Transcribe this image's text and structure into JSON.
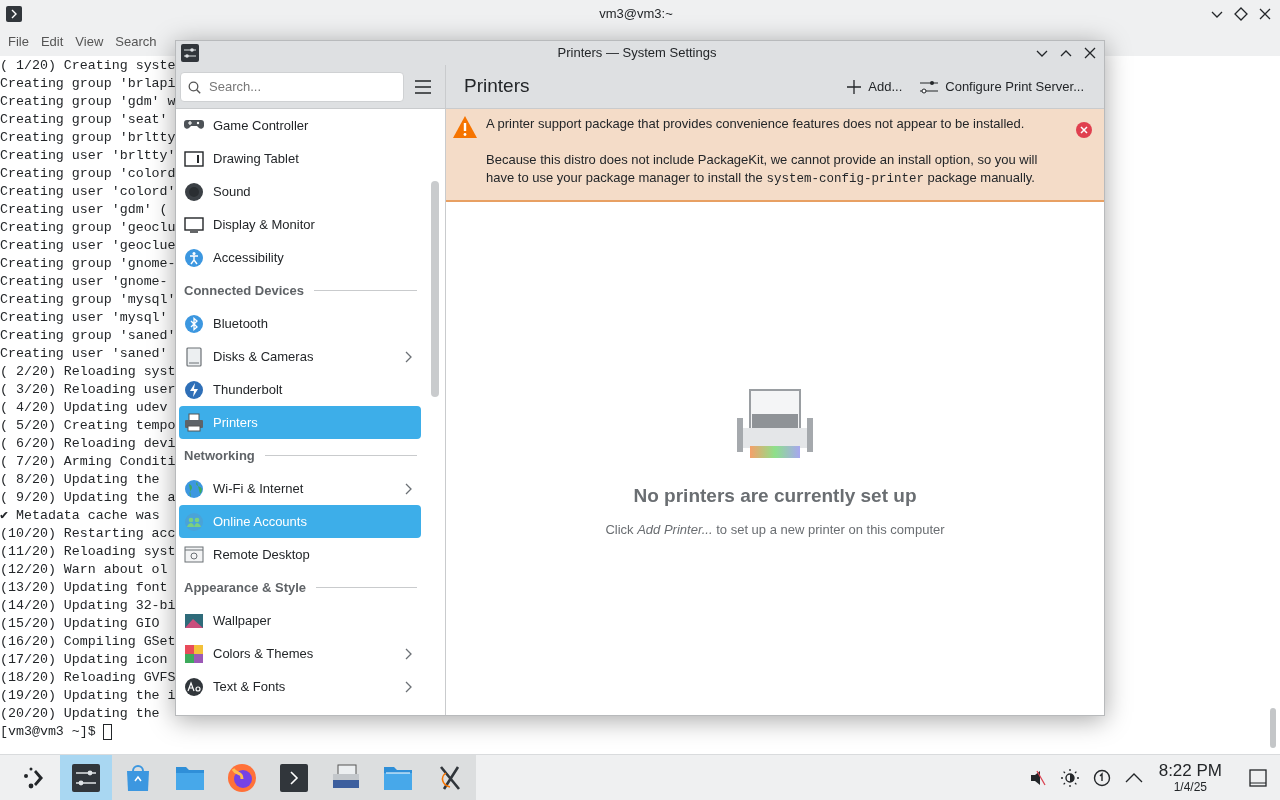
{
  "terminal": {
    "title": "vm3@vm3:~",
    "menu": [
      "File",
      "Edit",
      "View",
      "Search"
    ],
    "lines": [
      "( 1/20) Creating syste",
      "Creating group 'brlapi",
      "Creating group 'gdm' w",
      "Creating group 'seat'",
      "Creating group 'brltty",
      "Creating user 'brltty'",
      "Creating group 'colord",
      "Creating user 'colord'",
      "Creating user 'gdm' (",
      "Creating group 'geoclu",
      "Creating user 'geoclue",
      "Creating group 'gnome-",
      "Creating user 'gnome-",
      "Creating group 'mysql'",
      "Creating user 'mysql'",
      "Creating group 'saned'",
      "Creating user 'saned'",
      "( 2/20) Reloading syst",
      "( 3/20) Reloading user",
      "( 4/20) Updating udev",
      "( 5/20) Creating tempo",
      "( 6/20) Reloading devi",
      "( 7/20) Arming Conditi",
      "( 8/20) Updating the",
      "( 9/20) Updating the a",
      "✔ Metadata cache was",
      "(10/20) Restarting acc",
      "(11/20) Reloading syst",
      "(12/20) Warn about ol",
      "(13/20) Updating font",
      "(14/20) Updating 32-bi",
      "(15/20) Updating GIO",
      "(16/20) Compiling GSet",
      "(17/20) Updating icon",
      "(18/20) Reloading GVFS",
      "(19/20) Updating the i",
      "(20/20) Updating the"
    ],
    "prompt": "[vm3@vm3 ~]$"
  },
  "settings": {
    "title": "Printers — System Settings",
    "search": {
      "placeholder": "Search..."
    },
    "page_title": "Printers",
    "actions": [
      {
        "kind": "add",
        "label": "Add..."
      },
      {
        "kind": "configure",
        "label": "Configure Print Server..."
      }
    ],
    "sidebar": [
      {
        "items": [
          {
            "kind": "gamepad",
            "label": "Game Controller",
            "has_children": false,
            "selected": false
          },
          {
            "kind": "tablet",
            "label": "Drawing Tablet",
            "has_children": false,
            "selected": false
          },
          {
            "kind": "sound",
            "label": "Sound",
            "has_children": false,
            "selected": false
          },
          {
            "kind": "monitor",
            "label": "Display & Monitor",
            "has_children": false,
            "selected": false
          },
          {
            "kind": "accessibility",
            "label": "Accessibility",
            "has_children": false,
            "selected": false
          }
        ]
      },
      {
        "heading": "Connected Devices",
        "items": [
          {
            "kind": "bluetooth",
            "label": "Bluetooth",
            "has_children": false,
            "selected": false
          },
          {
            "kind": "disk",
            "label": "Disks & Cameras",
            "has_children": true,
            "selected": false
          },
          {
            "kind": "thunderbolt",
            "label": "Thunderbolt",
            "has_children": false,
            "selected": false
          },
          {
            "kind": "printer",
            "label": "Printers",
            "has_children": false,
            "selected": true
          }
        ]
      },
      {
        "heading": "Networking",
        "items": [
          {
            "kind": "globe",
            "label": "Wi-Fi & Internet",
            "has_children": true,
            "selected": false
          },
          {
            "kind": "accounts",
            "label": "Online Accounts",
            "has_children": false,
            "selected": true
          },
          {
            "kind": "remote",
            "label": "Remote Desktop",
            "has_children": false,
            "selected": false
          }
        ]
      },
      {
        "heading": "Appearance & Style",
        "items": [
          {
            "kind": "wallpaper",
            "label": "Wallpaper",
            "has_children": false,
            "selected": false
          },
          {
            "kind": "colors",
            "label": "Colors & Themes",
            "has_children": true,
            "selected": false
          },
          {
            "kind": "fonts",
            "label": "Text & Fonts",
            "has_children": true,
            "selected": false
          }
        ]
      }
    ],
    "warning": {
      "title": "A printer support package that provides convenience features does not appear to be installed.",
      "body": [
        {
          "kind": "text",
          "text": "Because this distro does not include PackageKit, we cannot provide an install option, so you will have to use your package manager to install the "
        },
        {
          "kind": "code",
          "text": "system-config-printer"
        },
        {
          "kind": "text",
          "text": " package manually."
        }
      ]
    },
    "empty": {
      "title": "No printers are currently set up",
      "hint": "Click *Add Printer...* to set up a new printer on this computer"
    }
  },
  "taskbar": {
    "apps": [
      {
        "kind": "launcher",
        "active": false
      },
      {
        "kind": "settings",
        "active": true
      },
      {
        "kind": "store",
        "active": false
      },
      {
        "kind": "folder",
        "active": false
      },
      {
        "kind": "browser",
        "active": false
      },
      {
        "kind": "terminal",
        "active": false
      },
      {
        "kind": "printer",
        "active": false
      },
      {
        "kind": "files",
        "active": false
      },
      {
        "kind": "xserver",
        "active": false
      }
    ],
    "tray": [
      {
        "kind": "muted"
      },
      {
        "kind": "brightness"
      },
      {
        "kind": "gauge"
      },
      {
        "kind": "expand"
      }
    ],
    "clock": {
      "time": "8:22 PM",
      "date": "1/4/25"
    }
  }
}
